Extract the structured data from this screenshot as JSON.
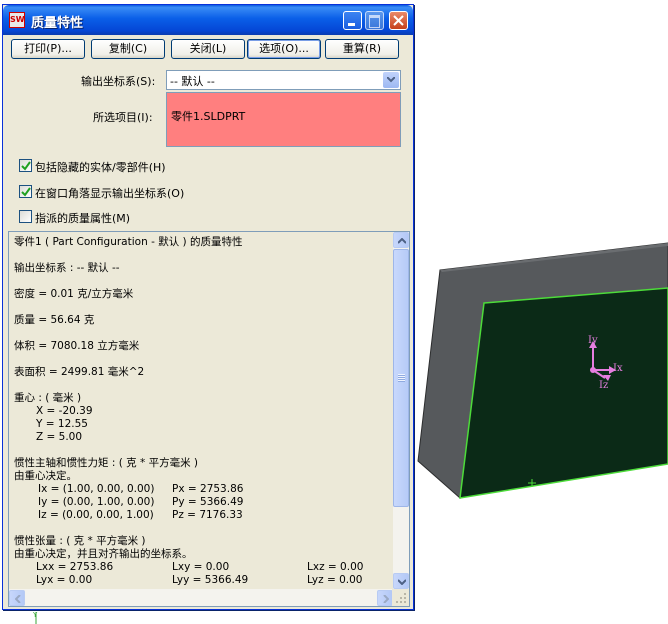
{
  "window": {
    "title": "质量特性",
    "icon": "solidworks-icon",
    "icon_text": "SW"
  },
  "toolbar": {
    "print_label": "打印(P)...",
    "copy_label": "复制(C)",
    "close_label": "关闭(L)",
    "options_label": "选项(O)...",
    "recalc_label": "重算(R)"
  },
  "form": {
    "coord_label": "输出坐标系(S):",
    "coord_value": "-- 默认 --",
    "selected_label": "所选项目(I):",
    "selected_value": "零件1.SLDPRT",
    "selected_bg": "#ff7f7f"
  },
  "options": {
    "hidden_bodies": {
      "label": "包括隐藏的实体/零部件(H)",
      "checked": true
    },
    "show_coord": {
      "label": "在窗口角落显示输出坐标系(O)",
      "checked": true
    },
    "assigned_props": {
      "label": "指派的质量属性(M)",
      "checked": false
    }
  },
  "results": {
    "header": "零件1 ( Part Configuration - 默认 ) 的质量特性",
    "coord": "输出坐标系 : -- 默认 --",
    "density": "密度 = 0.01 克/立方毫米",
    "mass": "质量 = 56.64 克",
    "volume": "体积 = 7080.18 立方毫米",
    "surface": "表面积 = 2499.81 毫米^2",
    "cg_title": "重心 : ( 毫米 )",
    "cg_x": "X = -20.39",
    "cg_y": "Y = 12.55",
    "cg_z": "Z = 5.00",
    "principal_title": "惯性主轴和惯性力矩 : ( 克 * 平方毫米 )",
    "principal_note": "由重心决定。",
    "ix": "Ix = (1.00, 0.00, 0.00)",
    "iy": "Iy = (0.00, 1.00, 0.00)",
    "iz": "Iz = (0.00, 0.00, 1.00)",
    "px": "Px = 2753.86",
    "py": "Py = 5366.49",
    "pz": "Pz = 7176.33",
    "tensor_title": "惯性张量 : ( 克 * 平方毫米 )",
    "tensor_note": "由重心决定，并且对齐输出的坐标系。",
    "lxx": "Lxx = 2753.86",
    "lxy": "Lxy = 0.00",
    "lxz": "Lxz = 0.00",
    "lyx": "Lyx = 0.00",
    "lyy": "Lyy = 5366.49",
    "lyz": "Lyz = 0.00"
  },
  "viewport": {
    "face_color": "#0b2a17",
    "side_color": "#56595c",
    "edge_color": "#4ddc3a",
    "triad_color": "#e67ee0",
    "axis_labels": {
      "x": "Ix",
      "y": "Iy",
      "z": "Iz"
    }
  },
  "colors": {
    "dialog_bg": "#ece9d8",
    "titlebar": "#0a5fe8",
    "accent_border": "#003c74"
  }
}
